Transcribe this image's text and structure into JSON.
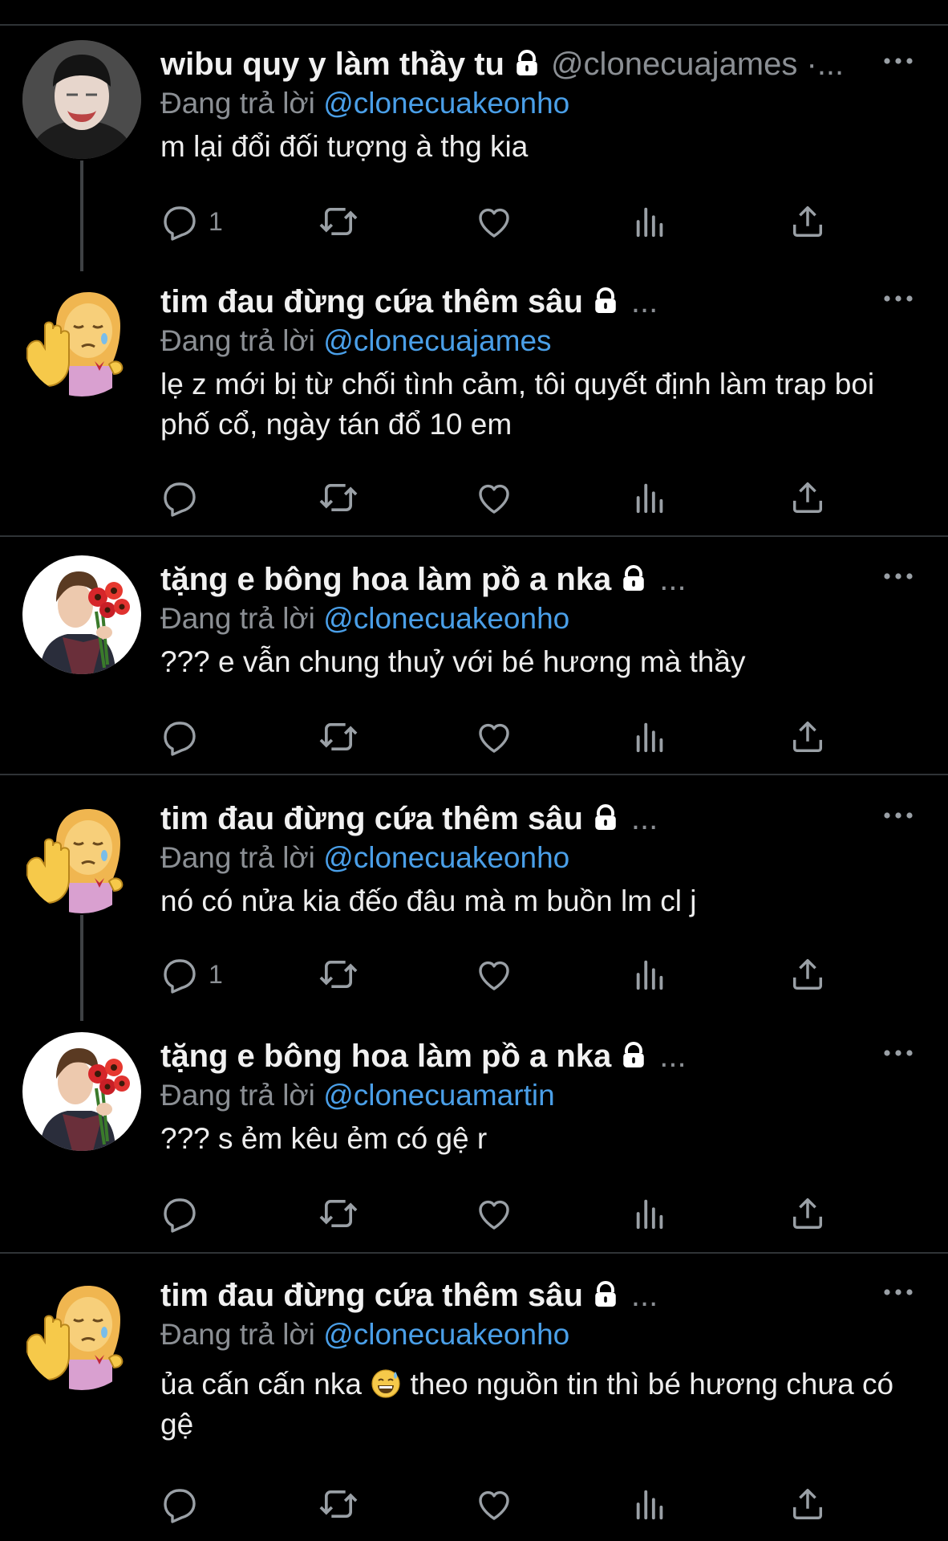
{
  "reply_prefix": "Đang trả lời",
  "colors": {
    "background": "#000000",
    "mention": "#4a9fe8",
    "muted": "#8b8f94",
    "divider": "#2f3336"
  },
  "tweets": [
    {
      "name": "wibu quy y làm thầy tu",
      "handle": "@clonecuajames",
      "handle_suffix": "·...",
      "mention": "@clonecuakeonho",
      "text": "m lại đổi đối tượng à thg kia",
      "reply_count": "1",
      "avatar": "avatar-man-photo",
      "locked": true
    },
    {
      "name": "tim đau đừng cứa thêm sâu",
      "handle_suffix": "...",
      "mention": "@clonecuajames",
      "text": "lẹ z mới bị từ chối tình cảm, tôi quyết định làm trap boi phố cổ, ngày tán đổ 10 em",
      "reply_count": "",
      "avatar": "avatar-sad-girl-emoji",
      "locked": true
    },
    {
      "name": "tặng e bông hoa làm pồ a nka",
      "handle_suffix": "...",
      "mention": "@clonecuakeonho",
      "text": "??? e vẫn chung thuỷ với bé hương mà thầy",
      "reply_count": "",
      "avatar": "avatar-boy-flowers",
      "locked": true
    },
    {
      "name": "tim đau đừng cứa thêm sâu",
      "handle_suffix": "...",
      "mention": "@clonecuakeonho",
      "text": "nó có nửa kia đếo đâu mà m buồn lm cl j",
      "reply_count": "1",
      "avatar": "avatar-sad-girl-emoji",
      "locked": true
    },
    {
      "name": "tặng e bông hoa làm pồ a nka",
      "handle_suffix": "...",
      "mention": "@clonecuamartin",
      "text": "??? s ẻm kêu ẻm có gệ r",
      "reply_count": "",
      "avatar": "avatar-boy-flowers",
      "locked": true
    },
    {
      "name": "tim đau đừng cứa thêm sâu",
      "handle_suffix": "...",
      "mention": "@clonecuakeonho",
      "text_before_emoji": "ủa cấn cấn nka",
      "emoji": "grinning-sweat-emoji",
      "text_after_emoji": " theo nguồn tin thì bé hương chưa có gệ",
      "reply_count": "",
      "avatar": "avatar-sad-girl-emoji",
      "locked": true
    }
  ]
}
